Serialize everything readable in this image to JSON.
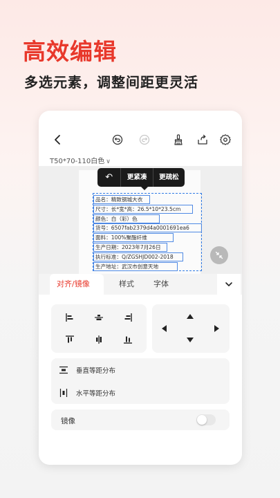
{
  "promo": {
    "headline": "高效编辑",
    "subline": "多选元素，调整间距更灵活"
  },
  "toolbar": {
    "back_icon": "chevron-left-icon",
    "undo_icon": "undo-icon",
    "redo_icon": "redo-icon",
    "clear_icon": "brush-icon",
    "save_icon": "export-icon",
    "settings_icon": "gear-icon"
  },
  "label_spec": "T50*70-110白色",
  "popup": {
    "undo": "↶",
    "tighter": "更紧凑",
    "looser": "更疏松"
  },
  "label_lines": [
    "品名：精致钢城大衣",
    "尺寸：长*宽*高：26.5*10*23.5cm",
    "颜色：白（彩）色",
    "货号：6507fab2379d4a0001691ea6",
    "面料：100%聚酯纤维",
    "生产日期：2023年7月26日",
    "执行标准：Q/ZGSHJD002-2018",
    "生产地址：武汉市创意天地"
  ],
  "tabs": [
    "对齐/镜像",
    "样式",
    "字体"
  ],
  "distribute": {
    "vertical": "垂直等距分布",
    "horizontal": "水平等距分布"
  },
  "mirror": {
    "label": "镜像",
    "enabled": false
  },
  "colors": {
    "accent": "#e8382b",
    "selection": "#2f7ae5"
  }
}
